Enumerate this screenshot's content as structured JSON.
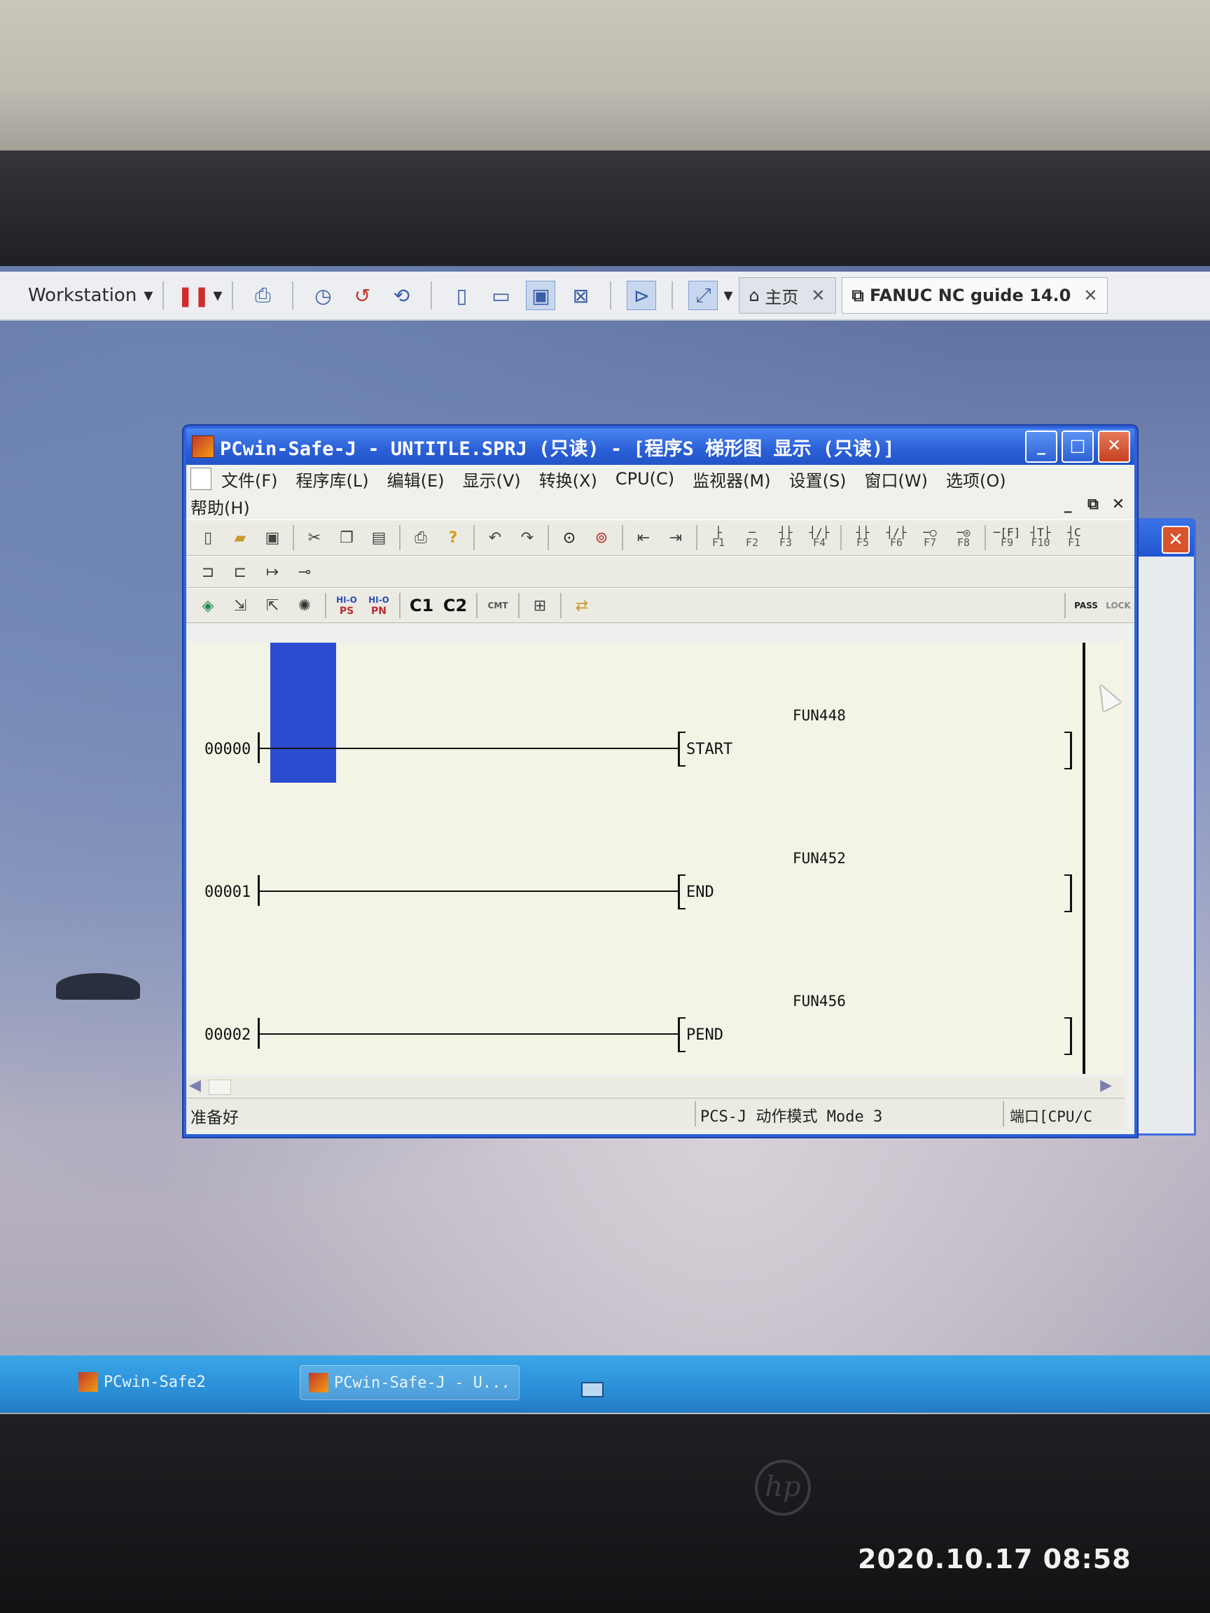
{
  "vmware": {
    "workstation_label": "Workstation",
    "tab_home": "主页",
    "tab_guide": "FANUC NC guide 14.0"
  },
  "window": {
    "title": "PCwin-Safe-J - UNTITLE.SPRJ (只读) - [程序S 梯形图  显示 (只读)]",
    "menu": [
      "文件(F)",
      "程序库(L)",
      "编辑(E)",
      "显示(V)",
      "转换(X)",
      "CPU(C)",
      "监视器(M)",
      "设置(S)",
      "窗口(W)",
      "选项(O)"
    ],
    "menu_help": "帮助(H)",
    "toolbar": {
      "fkeys": [
        "F1",
        "F2",
        "F3",
        "F4",
        "F5",
        "F6",
        "F7",
        "F8",
        "F9",
        "F10",
        "F1"
      ],
      "ps_top": "HI-O",
      "ps": "PS",
      "pn_top": "HI-O",
      "pn": "PN",
      "c1": "C1",
      "c2": "C2",
      "cmt": "CMT",
      "pass": "PASS",
      "lock": "LOCK"
    },
    "ladder": {
      "rungs": [
        {
          "step": "00000",
          "instruction": "START",
          "function": "FUN448"
        },
        {
          "step": "00001",
          "instruction": "END",
          "function": "FUN452"
        },
        {
          "step": "00002",
          "instruction": "PEND",
          "function": "FUN456"
        }
      ]
    },
    "status": {
      "ready": "准备好",
      "mode": "PCS-J 动作模式  Mode 3",
      "port": "端口[CPU/C"
    }
  },
  "taskbar": {
    "items": [
      "PCwin-Safe2",
      "PCwin-Safe-J - U..."
    ]
  },
  "photo": {
    "timestamp": "2020.10.17 08:58",
    "brand": "hp"
  }
}
